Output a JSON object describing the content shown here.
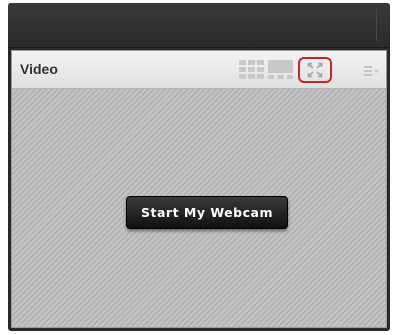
{
  "pod": {
    "title": "Video",
    "start_webcam_label": "Start My Webcam"
  },
  "icons": {
    "grid_layout": "grid-layout-icon",
    "filmstrip_layout": "filmstrip-layout-icon",
    "fullscreen": "fullscreen-icon",
    "pod_menu": "pod-menu-icon"
  },
  "colors": {
    "highlight": "#d0202a",
    "button_bg": "#1c1c1c",
    "button_text": "#ffffff"
  }
}
